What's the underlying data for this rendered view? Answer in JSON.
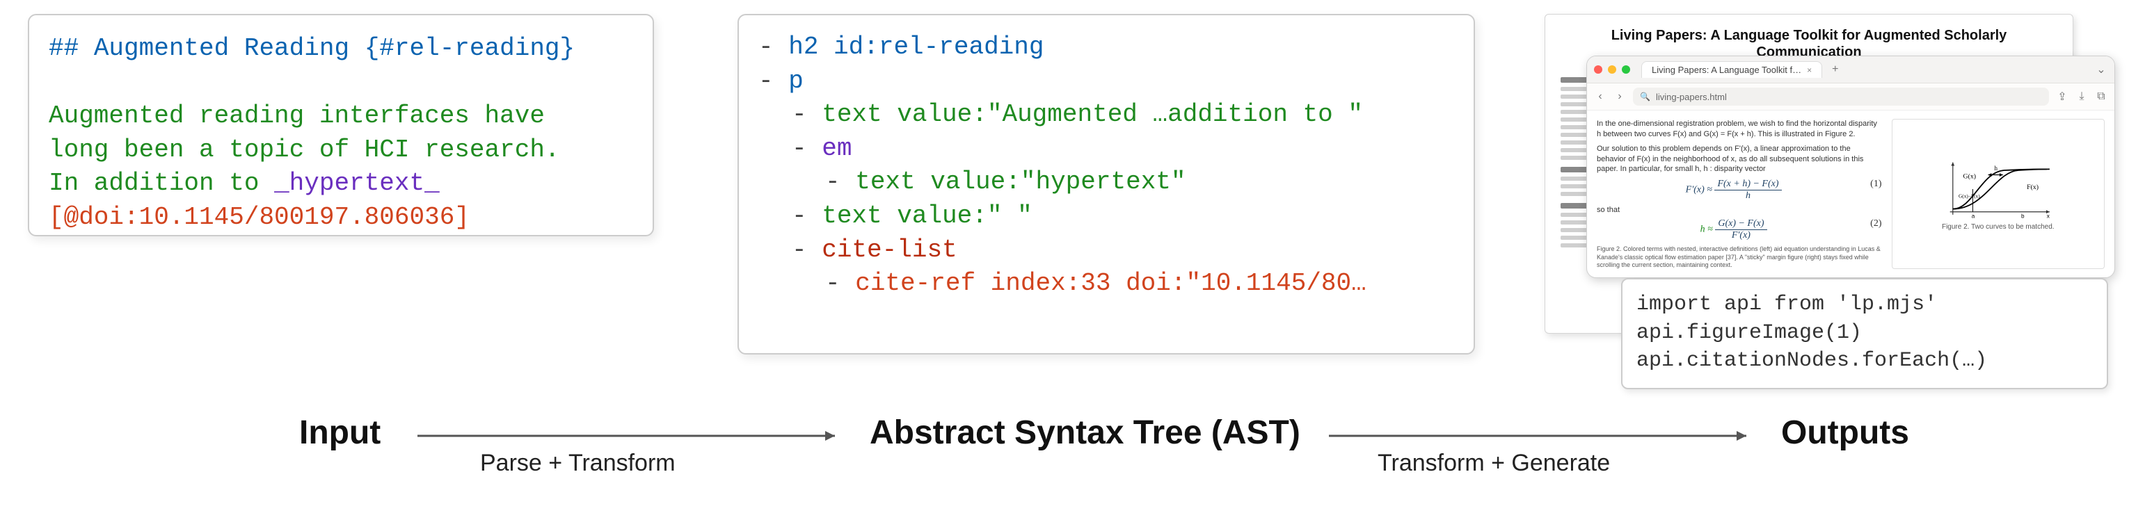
{
  "input_panel": {
    "heading_marks": "## ",
    "heading_text": "Augmented Reading ",
    "heading_attr": "{#rel-reading}",
    "body_a": "Augmented reading interfaces have",
    "body_b": "long been a topic of HCI research.",
    "body_c_prefix": "In addition to ",
    "em_mark_open": "_",
    "em_text": "hypertext",
    "em_mark_close": "_",
    "cite": "[@doi:10.1145/800197.806036]"
  },
  "ast_panel": {
    "l1_node": "h2",
    "l1_attr": " id:rel-reading",
    "l2_node": "p",
    "l3_node": "text",
    "l3_val": " value:\"Augmented …addition to \"",
    "l4_node": "em",
    "l5_node": "text",
    "l5_val": " value:\"hypertext\"",
    "l6_node": "text",
    "l6_val": " value:\" \"",
    "l7_node": "cite-list",
    "l8_node": "cite-ref",
    "l8_attr": " index:33 doi:\"10.1145/80…"
  },
  "outputs": {
    "paper_title": "Living Papers: A Language Toolkit for Augmented Scholarly Communication",
    "browser": {
      "tab_title": "Living Papers: A Language Toolkit f…",
      "tab_close": "×",
      "tab_plus": "+",
      "url_text": "living-papers.html",
      "content_intro": "In the one-dimensional registration problem, we wish to find the horizontal disparity h between two curves F(x) and G(x) = F(x + h). This is illustrated in Figure 2.",
      "content_para2": "Our solution to this problem depends on F'(x), a linear approximation to the behavior of F(x) in the neighborhood of x, as do all subsequent solutions in this paper. In particular, for small h,     h : disparity vector",
      "eqn1_top": "F(x + h) − F(x)",
      "eqn1_bottom": "h",
      "eqn1_lhs": "F'(x) ≈ ",
      "eqn1_tag": "(1)",
      "so_that": "so that",
      "eqn2_lhs": "h ≈ ",
      "eqn2_top": "G(x) − F(x)",
      "eqn2_bottom": "F'(x)",
      "eqn2_tag": "(2)",
      "fig_caption_main": "Figure 2. Colored terms with nested, interactive definitions (left) aid equation understanding in Lucas & Kanade's classic optical flow estimation paper [37]. A \"sticky\" margin figure (right) stays fixed while scrolling the current section, maintaining context.",
      "fig2_caption": "Figure 2. Two curves to be matched.",
      "curve_label_g": "G(x)",
      "curve_label_f": "F(x)",
      "curve_label_gf": "G(x)−F(x)",
      "curve_label_h": "h",
      "axis_a": "a",
      "axis_b": "b",
      "axis_x": "x"
    },
    "api": {
      "l1": "import api from 'lp.mjs'",
      "l2": "api.figureImage(1)",
      "l3": "api.citationNodes.forEach(…)"
    }
  },
  "flow": {
    "input_label": "Input",
    "ast_label": "Abstract Syntax Tree (AST)",
    "outputs_label": "Outputs",
    "step1": "Parse + Transform",
    "step2": "Transform + Generate"
  }
}
